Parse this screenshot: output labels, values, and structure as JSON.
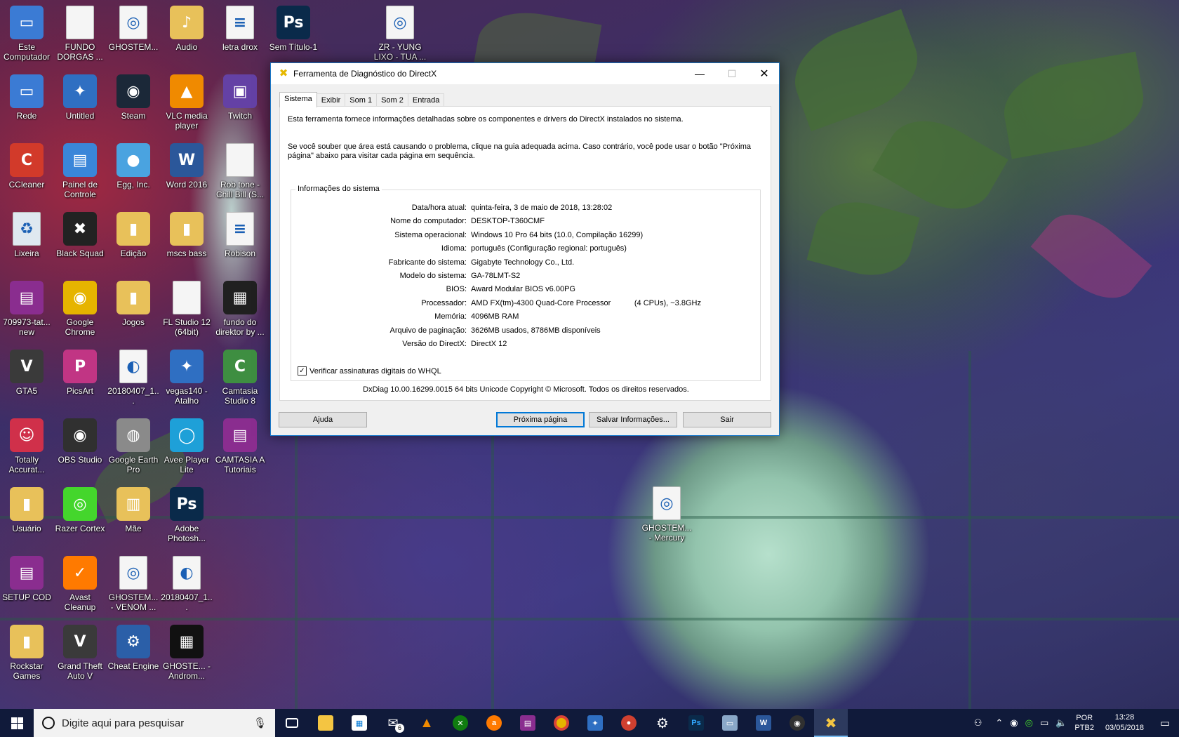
{
  "desktop": {
    "icons": [
      {
        "label": "Este Computador",
        "glyph": "▭",
        "color": "#3b7bd4"
      },
      {
        "label": "FUNDO DORGAS ...",
        "glyph": "",
        "color": "#f5f5f5"
      },
      {
        "label": "GHOSTEM...",
        "glyph": "◎",
        "color": "#f5f5f5"
      },
      {
        "label": "Audio",
        "glyph": "♪",
        "color": "#e8c15a"
      },
      {
        "label": "letra drox",
        "glyph": "≡",
        "color": "#f5f5f5"
      },
      {
        "label": "Sem Título-1",
        "glyph": "Ps",
        "color": "#0a2a4a"
      },
      {
        "label": "ZR - YUNG LIXO - TUA ...",
        "glyph": "◎",
        "color": "#f5f5f5"
      },
      {
        "label": "Rede",
        "glyph": "▭",
        "color": "#3b7bd4"
      },
      {
        "label": "Untitled",
        "glyph": "✦",
        "color": "#2f6fc2"
      },
      {
        "label": "Steam",
        "glyph": "◉",
        "color": "#1b2838"
      },
      {
        "label": "VLC media player",
        "glyph": "▲",
        "color": "#f08a00"
      },
      {
        "label": "Twitch",
        "glyph": "▣",
        "color": "#6441a5"
      },
      {
        "label": "CCleaner",
        "glyph": "C",
        "color": "#d23a2a"
      },
      {
        "label": "Painel de Controle",
        "glyph": "▤",
        "color": "#3a86d9"
      },
      {
        "label": "Egg, Inc.",
        "glyph": "●",
        "color": "#4aa3e0"
      },
      {
        "label": "Word 2016",
        "glyph": "W",
        "color": "#2b579a"
      },
      {
        "label": "Rob tone - Chill Bill (S...",
        "glyph": "",
        "color": "#f5f5f5"
      },
      {
        "label": "Lixeira",
        "glyph": "♻",
        "color": "#dfe8f0"
      },
      {
        "label": "Black Squad",
        "glyph": "✖",
        "color": "#222222"
      },
      {
        "label": "Edição",
        "glyph": "▮",
        "color": "#e8c15a"
      },
      {
        "label": "mscs bass",
        "glyph": "▮",
        "color": "#e8c15a"
      },
      {
        "label": "Robison",
        "glyph": "≡",
        "color": "#f5f5f5"
      },
      {
        "label": "709973-tat... new",
        "glyph": "▤",
        "color": "#8a2d8f"
      },
      {
        "label": "Google Chrome",
        "glyph": "◉",
        "color": "#e6b400"
      },
      {
        "label": "Jogos",
        "glyph": "▮",
        "color": "#e8c15a"
      },
      {
        "label": "FL Studio 12 (64bit)",
        "glyph": "",
        "color": "#f5f5f5"
      },
      {
        "label": "fundo do direktor by ...",
        "glyph": "▦",
        "color": "#202020"
      },
      {
        "label": "GTA5",
        "glyph": "V",
        "color": "#3a3a3a"
      },
      {
        "label": "PicsArt",
        "glyph": "P",
        "color": "#c13584"
      },
      {
        "label": "20180407_1...",
        "glyph": "◐",
        "color": "#f5f5f5"
      },
      {
        "label": "vegas140 - Atalho",
        "glyph": "✦",
        "color": "#2f6fc2"
      },
      {
        "label": "Camtasia Studio 8",
        "glyph": "C",
        "color": "#3e8e41"
      },
      {
        "label": "Totally Accurat...",
        "glyph": "☺",
        "color": "#d0304a"
      },
      {
        "label": "OBS Studio",
        "glyph": "◉",
        "color": "#303030"
      },
      {
        "label": "Google Earth Pro",
        "glyph": "◍",
        "color": "#8a8a8a"
      },
      {
        "label": "Avee Player Lite",
        "glyph": "◯",
        "color": "#1ea0d8"
      },
      {
        "label": "CAMTASIA A Tutoriais",
        "glyph": "▤",
        "color": "#8a2d8f"
      },
      {
        "label": "Usuário",
        "glyph": "▮",
        "color": "#e8c15a"
      },
      {
        "label": "Razer Cortex",
        "glyph": "◎",
        "color": "#44d62c"
      },
      {
        "label": "Mãe",
        "glyph": "▥",
        "color": "#e8c15a"
      },
      {
        "label": "Adobe Photosh...",
        "glyph": "Ps",
        "color": "#0a2a4a"
      },
      {
        "label": "SETUP COD",
        "glyph": "▤",
        "color": "#8a2d8f"
      },
      {
        "label": "Avast Cleanup",
        "glyph": "✓",
        "color": "#ff7a00"
      },
      {
        "label": "GHOSTEM... - VENOM ...",
        "glyph": "◎",
        "color": "#f5f5f5"
      },
      {
        "label": "20180407_1...",
        "glyph": "◐",
        "color": "#f5f5f5"
      },
      {
        "label": "Rockstar Games",
        "glyph": "▮",
        "color": "#e8c15a"
      },
      {
        "label": "Grand Theft Auto V",
        "glyph": "V",
        "color": "#3a3a3a"
      },
      {
        "label": "Cheat Engine",
        "glyph": "⚙",
        "color": "#2b5fa8"
      },
      {
        "label": "GHOSTE... - Androm...",
        "glyph": "▦",
        "color": "#111111"
      },
      {
        "label": "GHOSTEM... - Mercury",
        "glyph": "◎",
        "color": "#f5f5f5"
      }
    ]
  },
  "dxdiag": {
    "title": "Ferramenta de Diagnóstico do DirectX",
    "tabs": [
      "Sistema",
      "Exibir",
      "Som 1",
      "Som 2",
      "Entrada"
    ],
    "intro1": "Esta ferramenta fornece informações detalhadas sobre os componentes e drivers do DirectX instalados no sistema.",
    "intro2": "Se você souber que área está causando o problema, clique na guia adequada acima. Caso contrário, você pode usar o botão \"Próxima página\" abaixo para visitar cada página em sequência.",
    "group_title": "Informações do sistema",
    "rows": [
      {
        "k": "Data/hora atual:",
        "v": "quinta-feira, 3 de maio de 2018, 13:28:02"
      },
      {
        "k": "Nome do computador:",
        "v": "DESKTOP-T360CMF"
      },
      {
        "k": "Sistema operacional:",
        "v": "Windows 10 Pro 64 bits (10.0, Compilação 16299)"
      },
      {
        "k": "Idioma:",
        "v": "português (Configuração regional: português)"
      },
      {
        "k": "Fabricante do sistema:",
        "v": "Gigabyte Technology Co., Ltd."
      },
      {
        "k": "Modelo do sistema:",
        "v": "GA-78LMT-S2"
      },
      {
        "k": "BIOS:",
        "v": "Award Modular BIOS v6.00PG"
      },
      {
        "k": "Processador:",
        "v": "AMD FX(tm)-4300 Quad-Core Processor           (4 CPUs), ~3.8GHz"
      },
      {
        "k": "Memória:",
        "v": "4096MB RAM"
      },
      {
        "k": "Arquivo de paginação:",
        "v": "3626MB usados, 8786MB disponíveis"
      },
      {
        "k": "Versão do DirectX:",
        "v": "DirectX 12"
      }
    ],
    "whql_label": "Verificar assinaturas digitais do WHQL",
    "whql_checked": true,
    "copyright": "DxDiag 10.00.16299.0015 64 bits Unicode  Copyright © Microsoft. Todos os direitos reservados.",
    "buttons": {
      "help": "Ajuda",
      "next": "Próxima página",
      "save": "Salvar Informações...",
      "exit": "Sair"
    }
  },
  "taskbar": {
    "search_placeholder": "Digite aqui para pesquisar",
    "mail_badge": "6",
    "apps": [
      "task-view",
      "file-explorer",
      "store",
      "mail",
      "vlc",
      "xbox",
      "avast",
      "winrar",
      "chrome",
      "vegas",
      "game",
      "settings",
      "photoshop",
      "remote",
      "word",
      "obs",
      "dxdiag"
    ],
    "language": "POR",
    "keyboard": "PTB2",
    "time": "13:28",
    "date": "03/05/2018"
  }
}
